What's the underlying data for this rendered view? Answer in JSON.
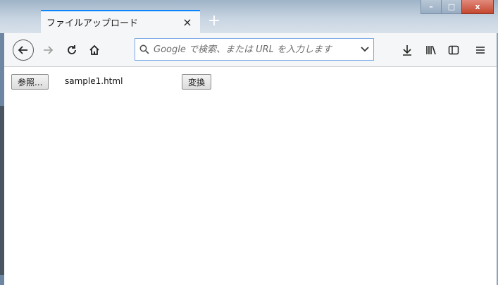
{
  "tab": {
    "title": "ファイルアップロード",
    "close_glyph": "×",
    "new_tab_glyph": "+"
  },
  "window_controls": {
    "minimize": "–",
    "maximize": "□",
    "close": "x"
  },
  "nav": {
    "back_icon": "back-arrow-icon",
    "forward_icon": "forward-arrow-icon",
    "reload_icon": "reload-icon",
    "home_icon": "home-icon"
  },
  "urlbar": {
    "placeholder": "Google で検索、または URL を入力します"
  },
  "toolbar_right": {
    "icons": [
      "download-icon",
      "library-icon",
      "sidebar-icon",
      "menu-icon"
    ]
  },
  "page": {
    "browse_button": "参照...",
    "selected_file": "sample1.html",
    "convert_button": "変換"
  },
  "colors": {
    "tab_accent": "#0a84ff",
    "urlbar_border": "#7aa7e6"
  }
}
